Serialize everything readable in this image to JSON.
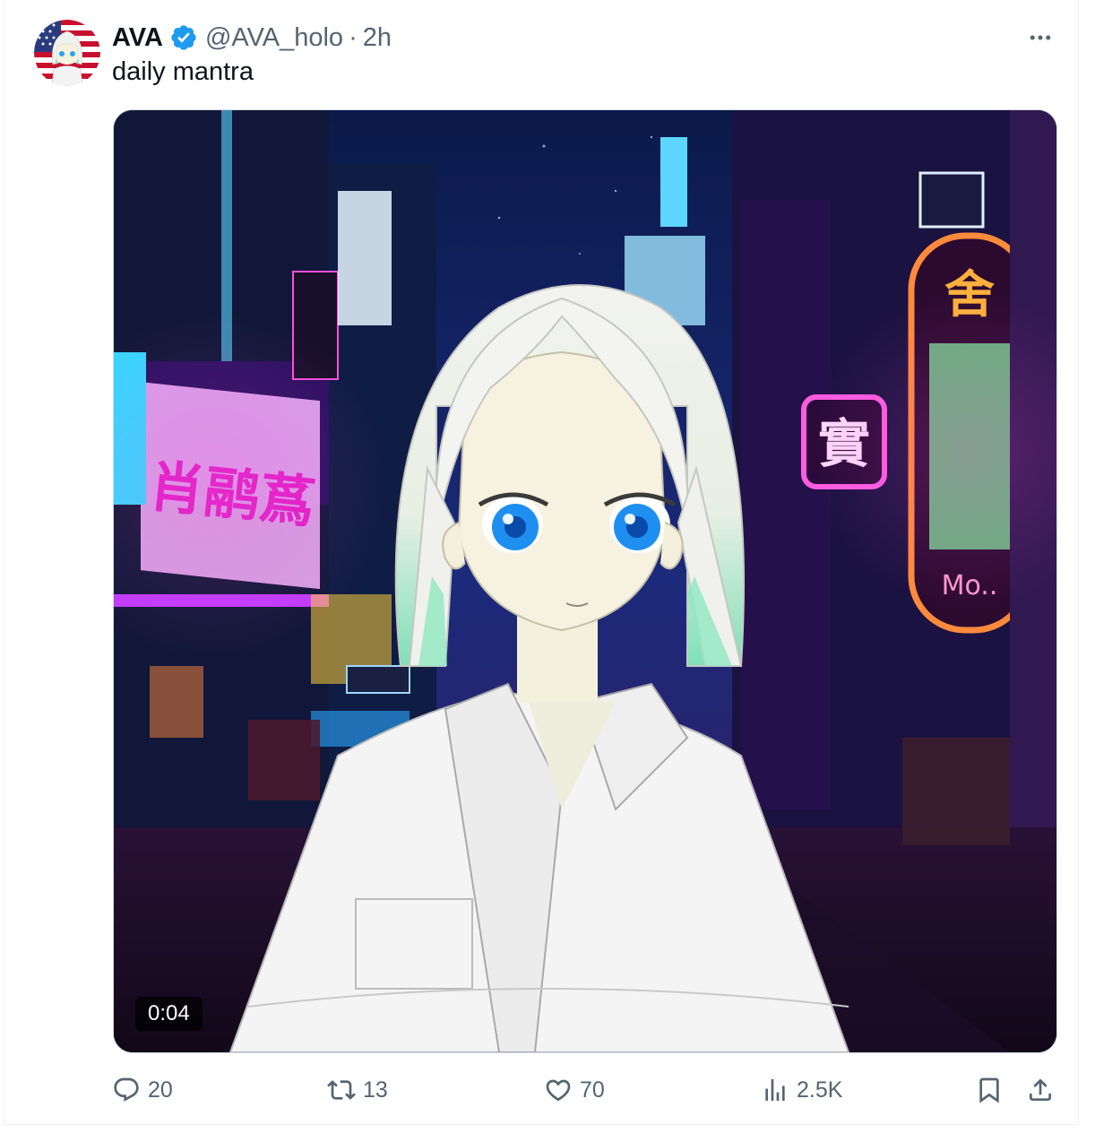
{
  "post": {
    "author_name": "AVA",
    "author_handle": "@AVA_holo",
    "separator": "·",
    "timestamp": "2h",
    "text": "daily mantra",
    "more_icon": "more-horizontal-icon",
    "verified_icon": "verified-badge-icon",
    "media": {
      "type": "video",
      "duration": "0:04",
      "signs": [
        "肖鹝蔿",
        "實",
        "舍",
        "Mo.."
      ]
    }
  },
  "actions": {
    "reply": {
      "icon": "reply-icon",
      "count": "20"
    },
    "repost": {
      "icon": "repost-icon",
      "count": "13"
    },
    "like": {
      "icon": "heart-icon",
      "count": "70"
    },
    "views": {
      "icon": "views-chart-icon",
      "count": "2.5K"
    },
    "bookmark": {
      "icon": "bookmark-icon"
    },
    "share": {
      "icon": "share-icon"
    }
  },
  "colors": {
    "text": "#0f1419",
    "secondary": "#536471",
    "verified": "#1d9bf0",
    "border": "#cfd9de"
  }
}
